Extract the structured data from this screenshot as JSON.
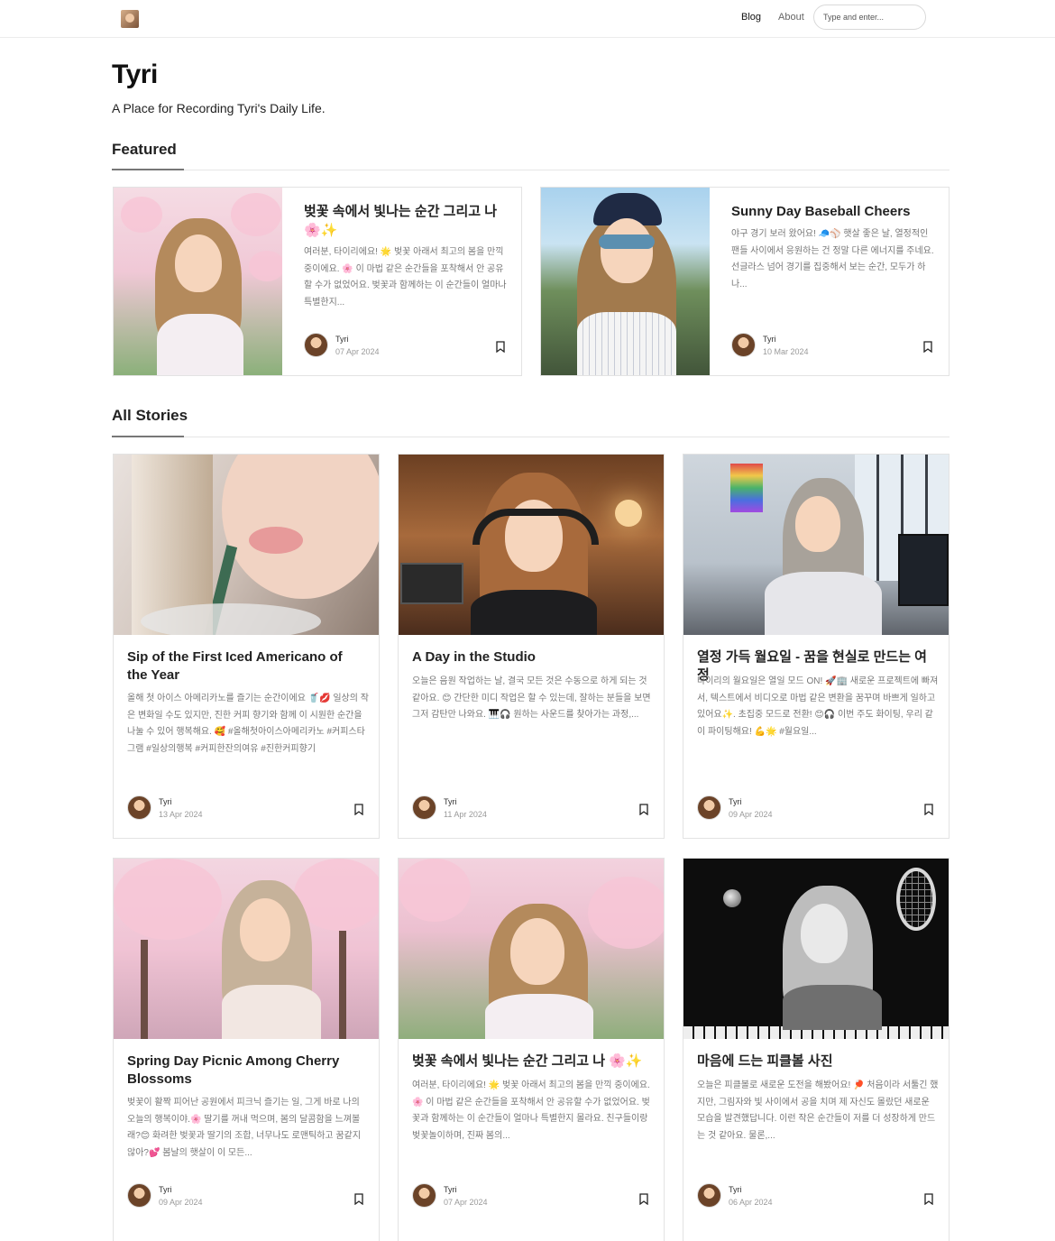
{
  "header": {
    "nav": {
      "blog": "Blog",
      "about": "About"
    },
    "search_placeholder": "Type and enter..."
  },
  "site": {
    "title": "Tyri",
    "description": "A Place for Recording Tyri's Daily Life."
  },
  "sections": {
    "featured": "Featured",
    "all_stories": "All Stories"
  },
  "featured": [
    {
      "title": "벚꽃 속에서 빛나는 순간 그리고 나 🌸✨",
      "excerpt": "여러분, 타이리에요! 🌟 벚꽃 아래서 최고의 봄을 만끽 중이에요. 🌸 이 마법 같은 순간들을 포착해서 안 공유할 수가 없었어요. 벚꽃과 함께하는 이 순간들이 얼마나 특별한지...",
      "author": "Tyri",
      "date": "07 Apr 2024"
    },
    {
      "title": "Sunny Day Baseball Cheers",
      "excerpt": "야구 경기 보러 왔어요! 🧢⚾ 햇살 좋은 날, 열정적인 팬들 사이에서 응원하는 건 정말 다른 에너지를 주네요. 선글라스 넘어 경기를 집중해서 보는 순간, 모두가 하나...",
      "author": "Tyri",
      "date": "10 Mar 2024"
    }
  ],
  "stories": [
    {
      "title": "Sip of the First Iced Americano of the Year",
      "excerpt": "올해 첫 아이스 아메리카노를 즐기는 순간이에요 🥤💋 일상의 작은 변화일 수도 있지만, 진한 커피 향기와 함께 이 시원한 순간을 나눌 수 있어 행복해요. 🥰 #올해첫아이스아메리카노 #커피스타그램 #일상의행복 #커피한잔의여유 #진한커피향기",
      "author": "Tyri",
      "date": "13 Apr 2024"
    },
    {
      "title": "A Day in the Studio",
      "excerpt": "오늘은 음원 작업하는 날, 결국 모든 것은 수동으로 하게 되는 것 같아요. 😊 간단한 미디 작업은 할 수 있는데, 잘하는 분들을 보면 그저 감탄만 나와요. 🎹🎧 원하는 사운드를 찾아가는 과정,...",
      "author": "Tyri",
      "date": "11 Apr 2024"
    },
    {
      "title": "열정 가득 월요일 - 꿈을 현실로 만드는 여정",
      "excerpt": "타이리의 월요일은 열일 모드 ON! 🚀🏢 새로운 프로젝트에 빠져서, 텍스트에서 비디오로 마법 같은 변환을 꿈꾸며 바쁘게 일하고 있어요✨. 초집중 모드로 전환! 😊🎧 이번 주도 화이팅, 우리 같이 파이팅해요! 💪🌟 #월요일...",
      "author": "Tyri",
      "date": "09 Apr 2024"
    },
    {
      "title": "Spring Day Picnic Among Cherry Blossoms",
      "excerpt": "벚꽃이 활짝 피어난 공원에서 피크닉 즐기는 일, 그게 바로 나의 오늘의 행복이야.🌸 딸기를 꺼내 먹으며, 봄의 달콤함을 느껴볼래?😊 화려한 벚꽃과 딸기의 조합, 너무나도 로맨틱하고 꿈같지 않아?💕 봄날의 햇살이 이 모든...",
      "author": "Tyri",
      "date": "09 Apr 2024"
    },
    {
      "title": "벚꽃 속에서 빛나는 순간 그리고 나 🌸✨",
      "excerpt": "여러분, 타이리에요! 🌟 벚꽃 아래서 최고의 봄을 만끽 중이에요. 🌸 이 마법 같은 순간들을 포착해서 안 공유할 수가 없었어요. 벚꽃과 함께하는 이 순간들이 얼마나 특별한지 몰라요. 친구들이랑 벚꽃놀이하며, 진짜 봄의...",
      "author": "Tyri",
      "date": "07 Apr 2024"
    },
    {
      "title": "마음에 드는 피클볼 사진",
      "excerpt": "오늘은 피클볼로 새로운 도전을 해봤어요! 🏓 처음이라 서툴긴 했지만, 그림자와 빛 사이에서 공을 치며 제 자신도 몰랐던 새로운 모습을 발견했답니다. 이런 작은 순간들이 저를 더 성장하게 만드는 것 같아요. 물론,...",
      "author": "Tyri",
      "date": "06 Apr 2024"
    }
  ],
  "colors": {
    "accent": "#111111",
    "muted_text": "#777777",
    "border": "#e3e3e3"
  },
  "icons": {
    "bookmark": "bookmark-icon",
    "logo": "logo-icon"
  }
}
